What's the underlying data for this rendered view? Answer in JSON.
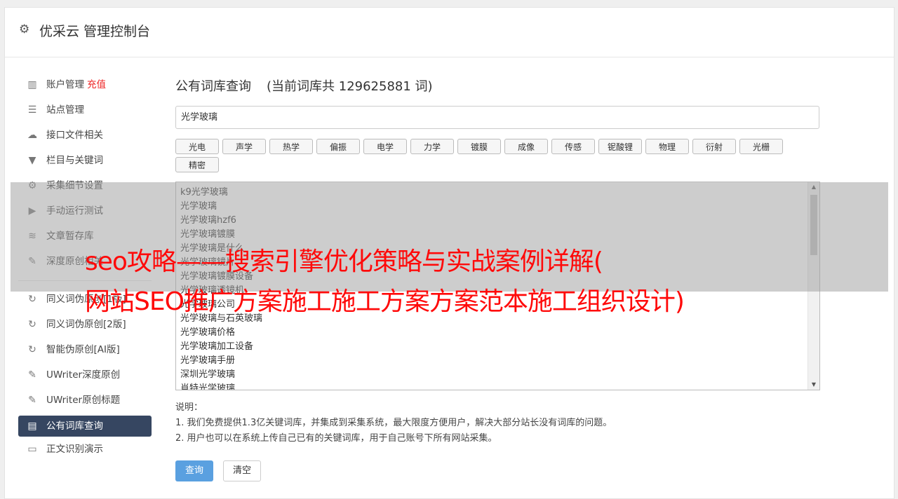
{
  "app": {
    "title": "优采云 管理控制台",
    "header_icon": "gear-icon"
  },
  "sidebar": {
    "group1": [
      {
        "label": "账户管理",
        "extra": "充值",
        "icon": "bar-chart-icon",
        "glyph": "▥"
      },
      {
        "label": "站点管理",
        "icon": "server-icon",
        "glyph": "☰"
      },
      {
        "label": "接口文件相关",
        "icon": "cloud-upload-icon",
        "glyph": "☁"
      },
      {
        "label": "栏目与关键词",
        "icon": "filter-icon",
        "glyph": "▼"
      },
      {
        "label": "采集细节设置",
        "icon": "cogs-icon",
        "glyph": "⚙"
      },
      {
        "label": "手动运行测试",
        "icon": "play-circle-icon",
        "glyph": "▶"
      },
      {
        "label": "文章暂存库",
        "icon": "database-icon",
        "glyph": "≋"
      },
      {
        "label": "深度原创相关",
        "icon": "edit-icon",
        "glyph": "✎"
      }
    ],
    "group2": [
      {
        "label": "同义词伪原创[1版]",
        "icon": "refresh-icon",
        "glyph": "↻"
      },
      {
        "label": "同义词伪原创[2版]",
        "icon": "refresh-icon",
        "glyph": "↻"
      },
      {
        "label": "智能伪原创[AI版]",
        "icon": "refresh-icon",
        "glyph": "↻"
      },
      {
        "label": "UWriter深度原创",
        "icon": "edit-icon",
        "glyph": "✎"
      },
      {
        "label": "UWriter原创标题",
        "icon": "edit-icon",
        "glyph": "✎"
      }
    ],
    "active": {
      "label": "公有词库查询",
      "icon": "book-icon",
      "glyph": "▤"
    },
    "after": [
      {
        "label": "正文识别演示",
        "icon": "monitor-icon",
        "glyph": "▭"
      }
    ]
  },
  "main": {
    "title": "公有词库查询",
    "count_text": "(当前词库共 129625881 词)",
    "search_value": "光学玻璃",
    "categories": [
      "光电",
      "声学",
      "热学",
      "偏振",
      "电学",
      "力学",
      "镀膜",
      "成像",
      "传感",
      "铌酸锂",
      "物理",
      "衍射",
      "光栅",
      "精密"
    ],
    "results": [
      "k9光学玻璃",
      "光学玻璃",
      "光学玻璃hzf6",
      "光学玻璃镀膜",
      "光学玻璃是什么",
      "光学玻璃镜片",
      "光学玻璃镀膜设备",
      "光学玻璃透镜机",
      "光学玻璃公司",
      "光学玻璃与石英玻璃",
      "光学玻璃价格",
      "光学玻璃加工设备",
      "光学玻璃手册",
      "深圳光学玻璃",
      "肖特光学玻璃"
    ],
    "notes_title": "说明：",
    "notes": [
      "1. 我们免费提供1.3亿关键词库，并集成到采集系统，最大限度方便用户，解决大部分站长没有词库的问题。",
      "2. 用户也可以在系统上传自己已有的关键词库，用于自己账号下所有网站采集。"
    ],
    "query_button": "查询",
    "clear_button": "清空"
  },
  "overlay": {
    "line1": "seo攻略——搜索引擎优化策略与实战案例详解(",
    "line2": "网站SEO推广方案施工施工方案方案范本施工组织设计)",
    "color": "#ff0a0a"
  }
}
